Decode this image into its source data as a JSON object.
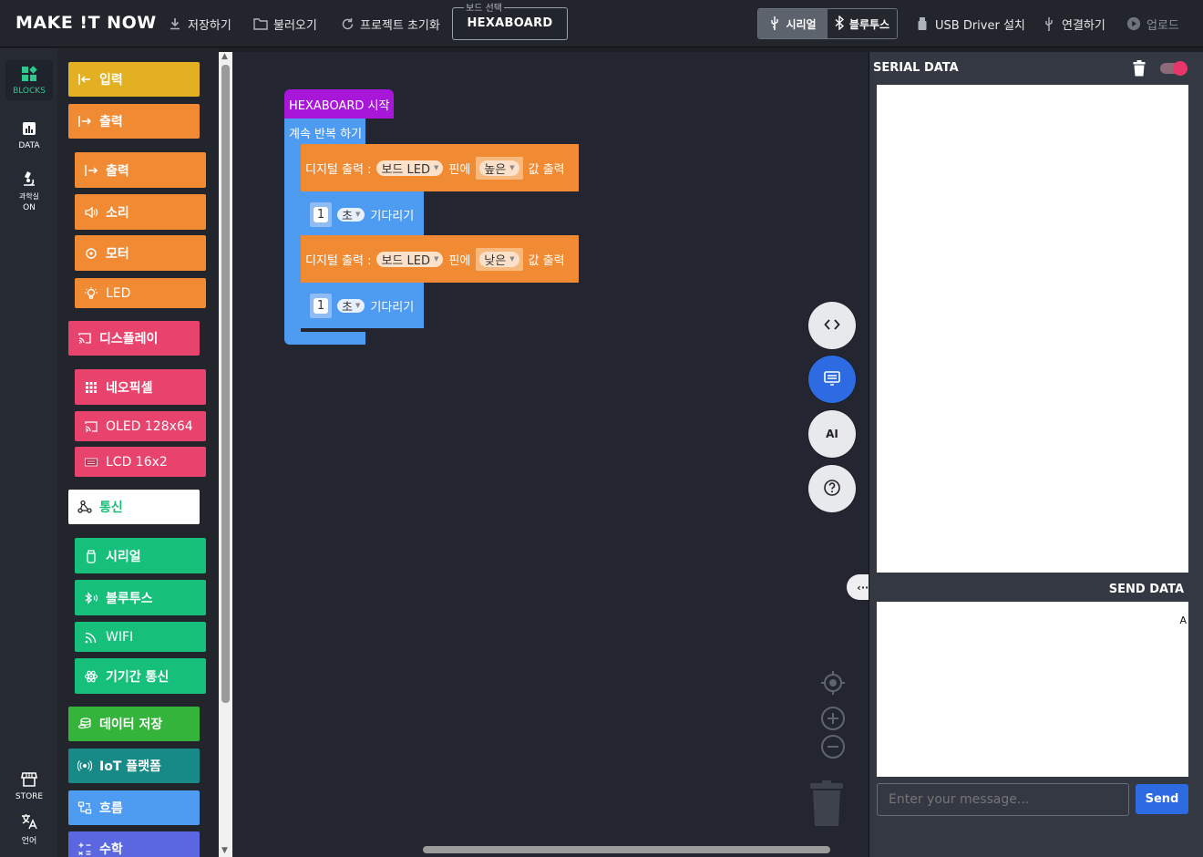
{
  "app": {
    "logo": "MAKE !T NOW"
  },
  "toolbar": {
    "save": "저장하기",
    "load": "불러오기",
    "reset": "프로젝트 초기화",
    "board_legend": "보드 선택",
    "board_value": "HEXABOARD",
    "serial": "시리얼",
    "bluetooth": "블루투스",
    "usb_driver": "USB Driver 설치",
    "connect": "연결하기",
    "upload": "업로드"
  },
  "rail": {
    "blocks": "BLOCKS",
    "data": "DATA",
    "science_line1": "과학실",
    "science_line2": "ON",
    "store": "STORE",
    "language": "언어"
  },
  "palette": [
    {
      "label": "입력",
      "color": "#e2b020"
    },
    {
      "label": "출력",
      "color": "#f08a33"
    },
    {
      "label": "출력",
      "color": "#f08a33"
    },
    {
      "label": "소리",
      "color": "#f08a33"
    },
    {
      "label": "모터",
      "color": "#f08a33"
    },
    {
      "label": "LED",
      "color": "#f08a33"
    },
    {
      "label": "디스플레이",
      "color": "#e8436c"
    },
    {
      "label": "네오픽셀",
      "color": "#e8436c"
    },
    {
      "label": "OLED 128x64",
      "color": "#e8436c"
    },
    {
      "label": "LCD 16x2",
      "color": "#e8436c"
    },
    {
      "label": "통신",
      "color": "#ffffff"
    },
    {
      "label": "시리얼",
      "color": "#17c07a"
    },
    {
      "label": "블루투스",
      "color": "#17c07a"
    },
    {
      "label": "WIFI",
      "color": "#17c07a"
    },
    {
      "label": "기기간 통신",
      "color": "#17c07a"
    },
    {
      "label": "데이터 저장",
      "color": "#35b43c"
    },
    {
      "label": "IoT 플랫폼",
      "color": "#178a87"
    },
    {
      "label": "흐름",
      "color": "#4e9cf1"
    },
    {
      "label": "수학",
      "color": "#5b67e0"
    }
  ],
  "workspace": {
    "hat": "HEXABOARD 시작",
    "loop": "계속 반복 하기",
    "b1": {
      "prefix": "디지털 출력 :",
      "pin": "보드 LED",
      "pin_label": "핀에",
      "value": "높은",
      "suffix": "값 출력"
    },
    "b2": {
      "num": "1",
      "unit": "초",
      "suffix": "기다리기"
    },
    "b3": {
      "prefix": "디지털 출력 :",
      "pin": "보드 LED",
      "pin_label": "핀에",
      "value": "낮은",
      "suffix": "값 출력"
    },
    "b4": {
      "num": "1",
      "unit": "초",
      "suffix": "기다리기"
    },
    "fab_ai": "AI"
  },
  "serial_panel": {
    "title": "SERIAL DATA",
    "send_title": "SEND DATA",
    "send_content": "A",
    "input_placeholder": "Enter your message...",
    "send_button": "Send"
  }
}
